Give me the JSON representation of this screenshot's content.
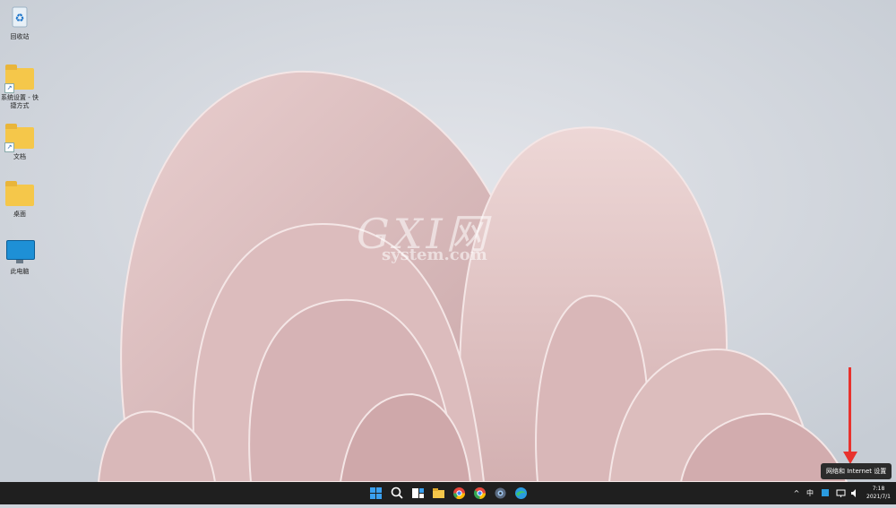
{
  "desktop": {
    "icons": [
      {
        "label": "回收站",
        "icon": "recycle-bin-icon"
      },
      {
        "label": "系统设置 - 快捷方式",
        "icon": "folder-icon"
      },
      {
        "label": "文档",
        "icon": "folder-icon"
      },
      {
        "label": "桌面",
        "icon": "folder-icon"
      },
      {
        "label": "此电脑",
        "icon": "this-pc-icon"
      }
    ]
  },
  "watermark": {
    "line1": "GXI网",
    "line2": "system.com"
  },
  "annotation": {
    "arrow_color": "#e8322d"
  },
  "tooltip": {
    "text": "网络和 Internet 设置"
  },
  "taskbar": {
    "apps": [
      "start-icon",
      "search-icon",
      "task-view-icon",
      "file-explorer-icon",
      "chrome-icon",
      "chrome-icon",
      "settings-icon",
      "edge-icon"
    ],
    "tray": {
      "chevron": "^",
      "ime": "中",
      "network_icon": "network-icon",
      "volume_icon": "volume-icon",
      "time": "7:18",
      "date": "2021/7/1"
    }
  }
}
